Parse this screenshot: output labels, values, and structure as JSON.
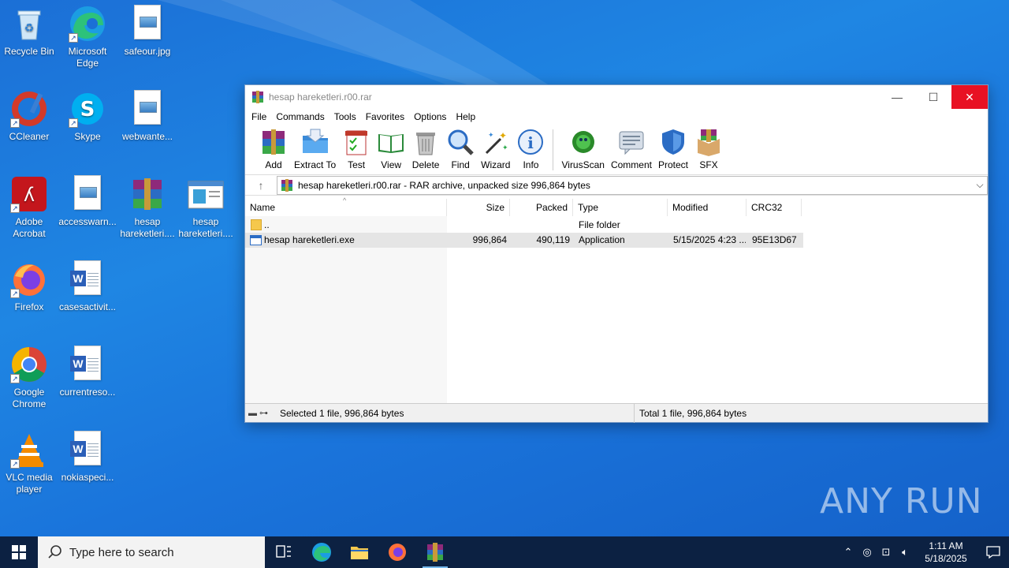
{
  "desktop": {
    "icons": [
      {
        "label": "Recycle Bin"
      },
      {
        "label": "Microsoft Edge"
      },
      {
        "label": "safeour.jpg"
      },
      {
        "label": "CCleaner"
      },
      {
        "label": "Skype"
      },
      {
        "label": "webwante..."
      },
      {
        "label": "Adobe Acrobat"
      },
      {
        "label": "accesswarn..."
      },
      {
        "label": "hesap hareketleri...."
      },
      {
        "label": "hesap hareketleri...."
      },
      {
        "label": "Firefox"
      },
      {
        "label": "casesactivit..."
      },
      {
        "label": "Google Chrome"
      },
      {
        "label": "currentreso..."
      },
      {
        "label": "VLC media player"
      },
      {
        "label": "nokiaspeci..."
      }
    ]
  },
  "window": {
    "title": "hesap hareketleri.r00.rar",
    "menu": [
      "File",
      "Commands",
      "Tools",
      "Favorites",
      "Options",
      "Help"
    ],
    "toolbar": [
      "Add",
      "Extract To",
      "Test",
      "View",
      "Delete",
      "Find",
      "Wizard",
      "Info",
      "VirusScan",
      "Comment",
      "Protect",
      "SFX"
    ],
    "address": "hesap hareketleri.r00.rar - RAR archive, unpacked size 996,864 bytes",
    "columns": [
      "Name",
      "Size",
      "Packed",
      "Type",
      "Modified",
      "CRC32"
    ],
    "rows": [
      {
        "name": "..",
        "size": "",
        "packed": "",
        "type": "File folder",
        "modified": "",
        "crc": ""
      },
      {
        "name": "hesap hareketleri.exe",
        "size": "996,864",
        "packed": "490,119",
        "type": "Application",
        "modified": "5/15/2025 4:23 ...",
        "crc": "95E13D67"
      }
    ],
    "status_left": "Selected 1 file, 996,864 bytes",
    "status_right": "Total 1 file, 996,864 bytes"
  },
  "taskbar": {
    "search_placeholder": "Type here to search",
    "time": "1:11 AM",
    "date": "5/18/2025"
  },
  "watermark": "ANY RUN"
}
